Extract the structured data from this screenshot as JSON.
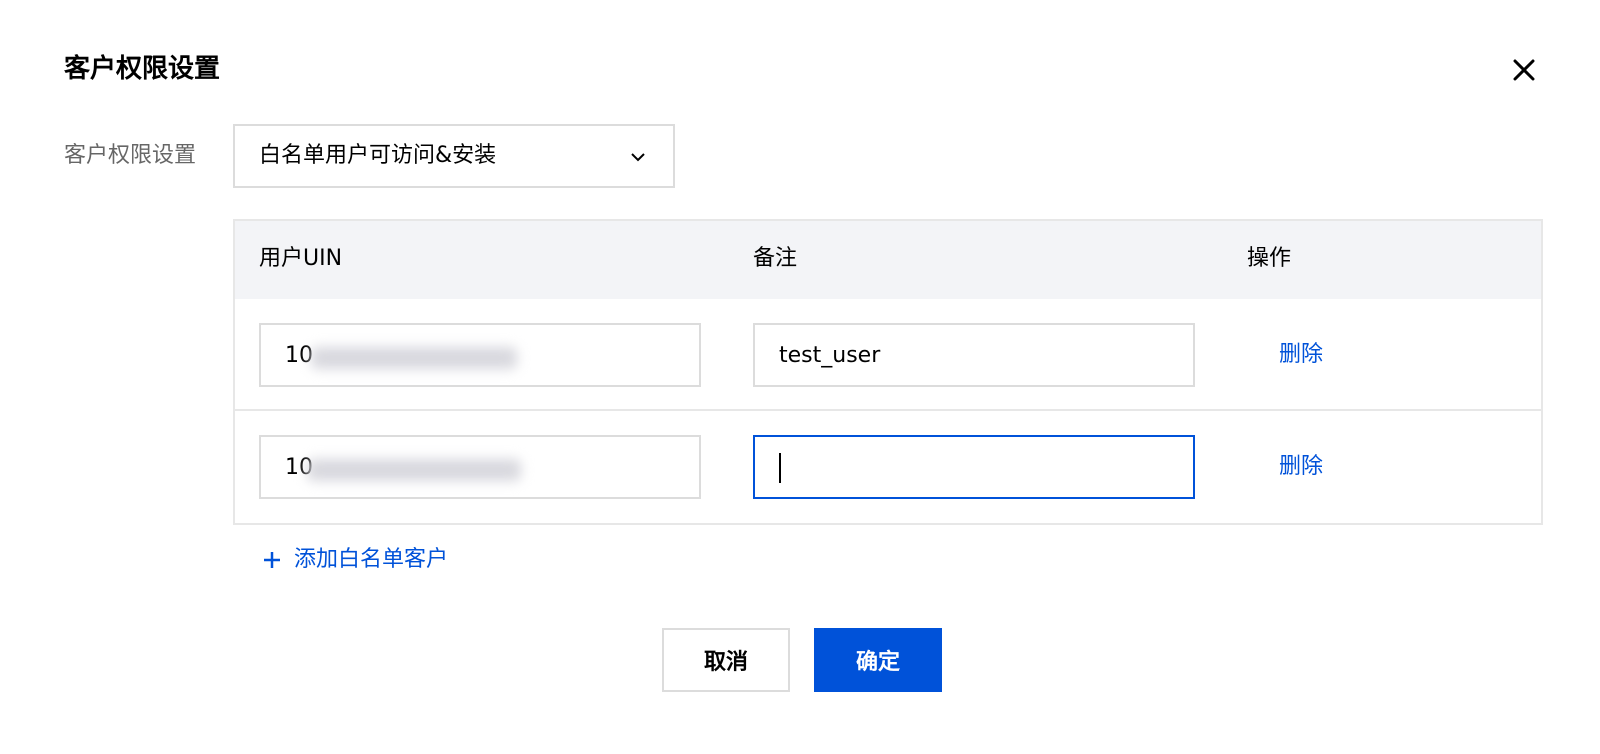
{
  "dialog": {
    "title": "客户权限设置",
    "close_icon": "close-icon"
  },
  "form": {
    "label": "客户权限设置",
    "select_value": "白名单用户可访问&安装",
    "select_icon": "chevron-down-icon"
  },
  "table": {
    "headers": [
      "用户UIN",
      "备注",
      "操作"
    ],
    "rows": [
      {
        "uin_visible": "10",
        "uin_blurred": true,
        "remark": "test_user",
        "action": "删除"
      },
      {
        "uin_visible": "10",
        "uin_blurred": true,
        "remark": "",
        "action": "删除",
        "remark_focused": true
      }
    ]
  },
  "add_link": {
    "label": "添加白名单客户",
    "icon": "plus-icon"
  },
  "footer": {
    "cancel_label": "取消",
    "confirm_label": "确定"
  },
  "colors": {
    "primary": "#0052d9",
    "border": "#dcdcdc",
    "header_bg": "#f3f4f7"
  }
}
